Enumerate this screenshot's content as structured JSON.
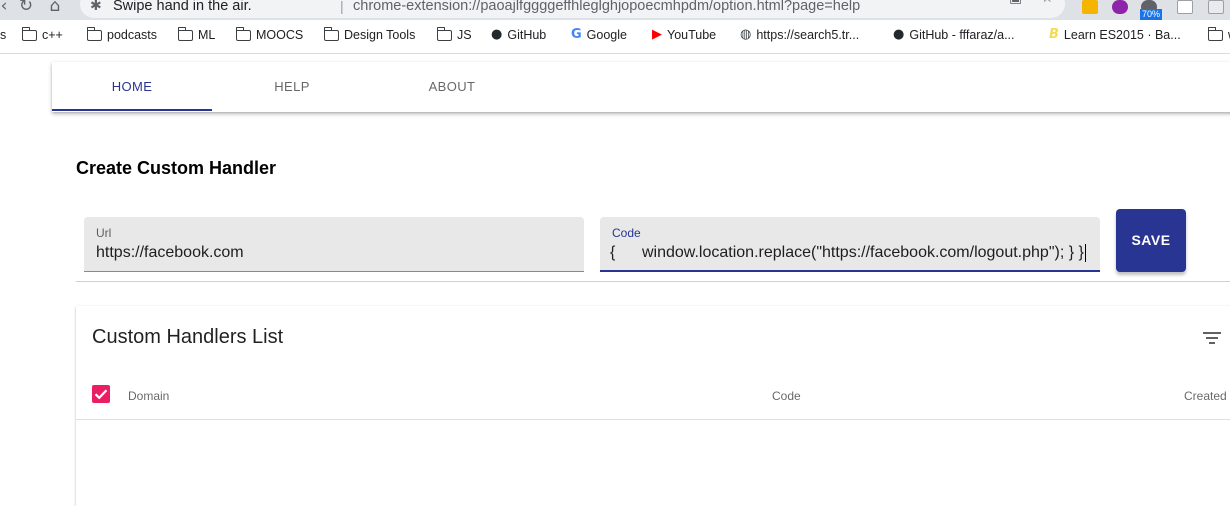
{
  "browser": {
    "tab_title": "Swipe hand in the air.",
    "url": "chrome-extension://paoajlfggggeffhleglghjopoecmhpdm/option.html?page=help",
    "extension_badge": "70%",
    "bookmarks": [
      {
        "label": "s",
        "icon": "none"
      },
      {
        "label": "c++",
        "icon": "folder-icon"
      },
      {
        "label": "podcasts",
        "icon": "folder-icon"
      },
      {
        "label": "ML",
        "icon": "folder-icon"
      },
      {
        "label": "MOOCS",
        "icon": "folder-icon"
      },
      {
        "label": "Design Tools",
        "icon": "folder-icon"
      },
      {
        "label": "JS",
        "icon": "folder-icon"
      },
      {
        "label": "GitHub",
        "icon": "github-icon"
      },
      {
        "label": "Google",
        "icon": "google-icon"
      },
      {
        "label": "YouTube",
        "icon": "youtube-icon"
      },
      {
        "label": "https://search5.tr...",
        "icon": "globe-icon"
      },
      {
        "label": "GitHub - fffaraz/a...",
        "icon": "github-icon"
      },
      {
        "label": "Learn ES2015 · Ba...",
        "icon": "babel-icon"
      },
      {
        "label": "w",
        "icon": "none"
      }
    ]
  },
  "nav": {
    "tabs": [
      {
        "label": "HOME",
        "active": true
      },
      {
        "label": "HELP",
        "active": false
      },
      {
        "label": "ABOUT",
        "active": false
      }
    ],
    "accent_color": "#283593"
  },
  "form": {
    "title": "Create Custom Handler",
    "url_field": {
      "label": "Url",
      "value": "https://facebook.com"
    },
    "code_field": {
      "label": "Code",
      "value_prefix": "{",
      "value": "window.location.replace(\"https://facebook.com/logout.php\");  } }"
    },
    "save_label": "SAVE"
  },
  "list": {
    "title": "Custom Handlers List",
    "select_all_checked": true,
    "checkbox_color": "#e91e63",
    "columns": [
      "Domain",
      "Code",
      "Created"
    ],
    "rows": []
  }
}
